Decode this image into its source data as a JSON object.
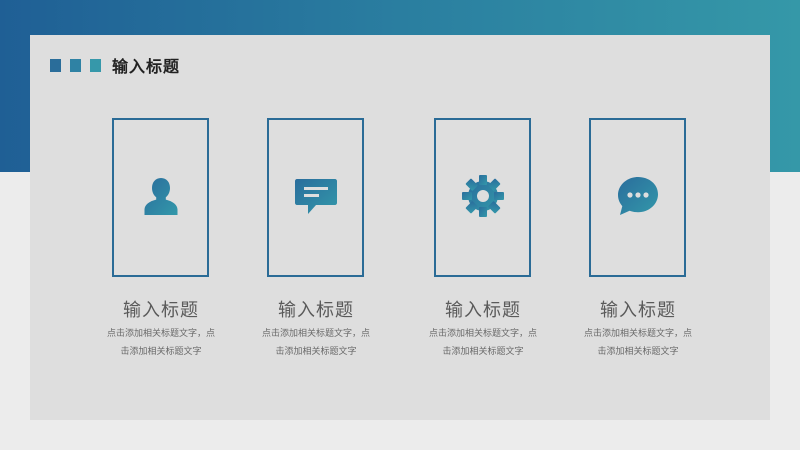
{
  "header": {
    "title": "输入标题"
  },
  "items": [
    {
      "icon": "user-icon",
      "title": "输入标题",
      "desc_line1": "点击添加相关标题文字，点",
      "desc_line2": "击添加相关标题文字"
    },
    {
      "icon": "message-icon",
      "title": "输入标题",
      "desc_line1": "点击添加相关标题文字，点",
      "desc_line2": "击添加相关标题文字"
    },
    {
      "icon": "gear-icon",
      "title": "输入标题",
      "desc_line1": "点击添加相关标题文字，点",
      "desc_line2": "击添加相关标题文字"
    },
    {
      "icon": "chat-bubble-icon",
      "title": "输入标题",
      "desc_line1": "点击添加相关标题文字，点",
      "desc_line2": "击添加相关标题文字"
    }
  ],
  "colors": {
    "accent_dark": "#1f5f95",
    "accent_light": "#3598a8",
    "icon": "#2a7ea0"
  }
}
